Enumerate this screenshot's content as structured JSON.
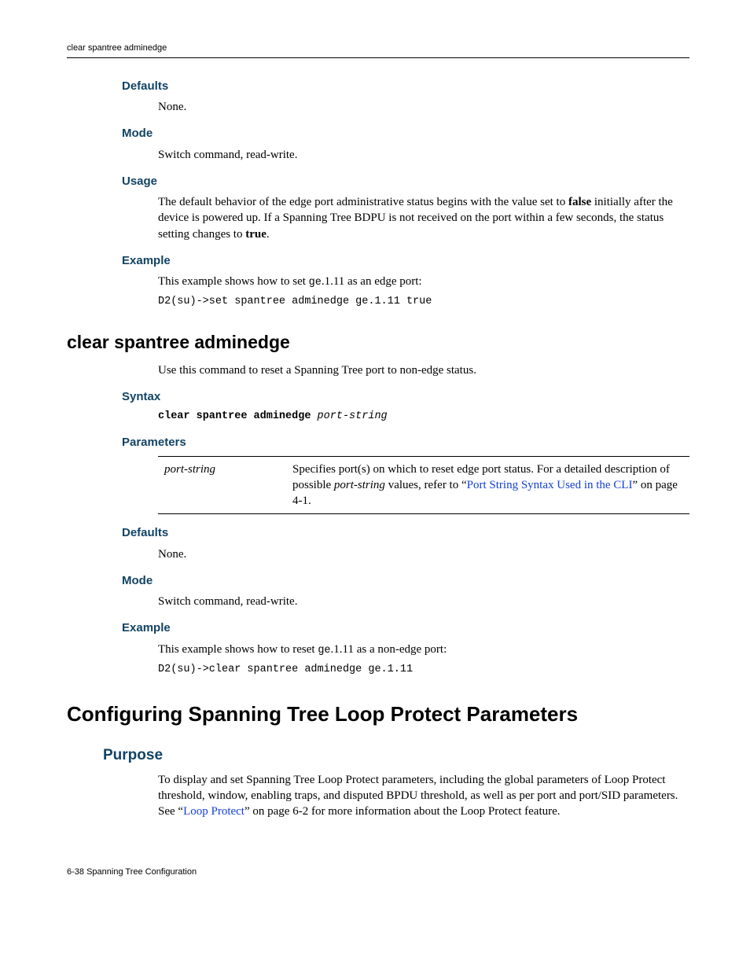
{
  "header": {
    "running": "clear spantree adminedge"
  },
  "s1": {
    "defaults_h": "Defaults",
    "defaults_body": "None.",
    "mode_h": "Mode",
    "mode_body": "Switch command, read-write.",
    "usage_h": "Usage",
    "usage_pre": "The default behavior of the edge port administrative status begins with the value set to ",
    "usage_bold1": "false",
    "usage_mid": " initially after the device is powered up. If a Spanning Tree BDPU is not received on the port within a few seconds, the status setting changes to ",
    "usage_bold2": "true",
    "usage_post": ".",
    "example_h": "Example",
    "example_intro_pre": "This example shows how to set ",
    "example_intro_ge": "ge",
    "example_intro_post": ".1.11 as an edge port:",
    "example_code": "D2(su)->set spantree adminedge ge.1.11 true"
  },
  "s2": {
    "title": "clear spantree adminedge",
    "intro": "Use this command to reset a Spanning Tree port to non-edge status.",
    "syntax_h": "Syntax",
    "syntax_cmd": "clear spantree adminedge ",
    "syntax_arg": "port-string",
    "params_h": "Parameters",
    "param_name": "port-string",
    "param_desc_pre": "Specifies port(s) on which to reset edge port status. For a detailed description of possible ",
    "param_desc_em": "port-string",
    "param_desc_mid": " values, refer to “",
    "param_desc_link": "Port String Syntax Used in the CLI",
    "param_desc_post": "” on page 4-1.",
    "defaults_h": "Defaults",
    "defaults_body": "None.",
    "mode_h": "Mode",
    "mode_body": "Switch command, read-write.",
    "example_h": "Example",
    "example_intro_pre": "This example shows how to reset ",
    "example_intro_ge": "ge",
    "example_intro_post": ".1.11 as a non-edge port:",
    "example_code": "D2(su)->clear spantree adminedge ge.1.11"
  },
  "s3": {
    "title": "Configuring Spanning Tree Loop Protect Parameters",
    "purpose_h": "Purpose",
    "purpose_pre": "To display and set Spanning Tree Loop Protect parameters, including the global parameters of Loop Protect threshold, window, enabling traps, and disputed BPDU threshold, as well as per port and port/SID parameters. See “",
    "purpose_link": "Loop Protect",
    "purpose_post": "” on page 6-2 for more information about the Loop Protect feature."
  },
  "footer": {
    "text": "6-38   Spanning Tree Configuration"
  }
}
